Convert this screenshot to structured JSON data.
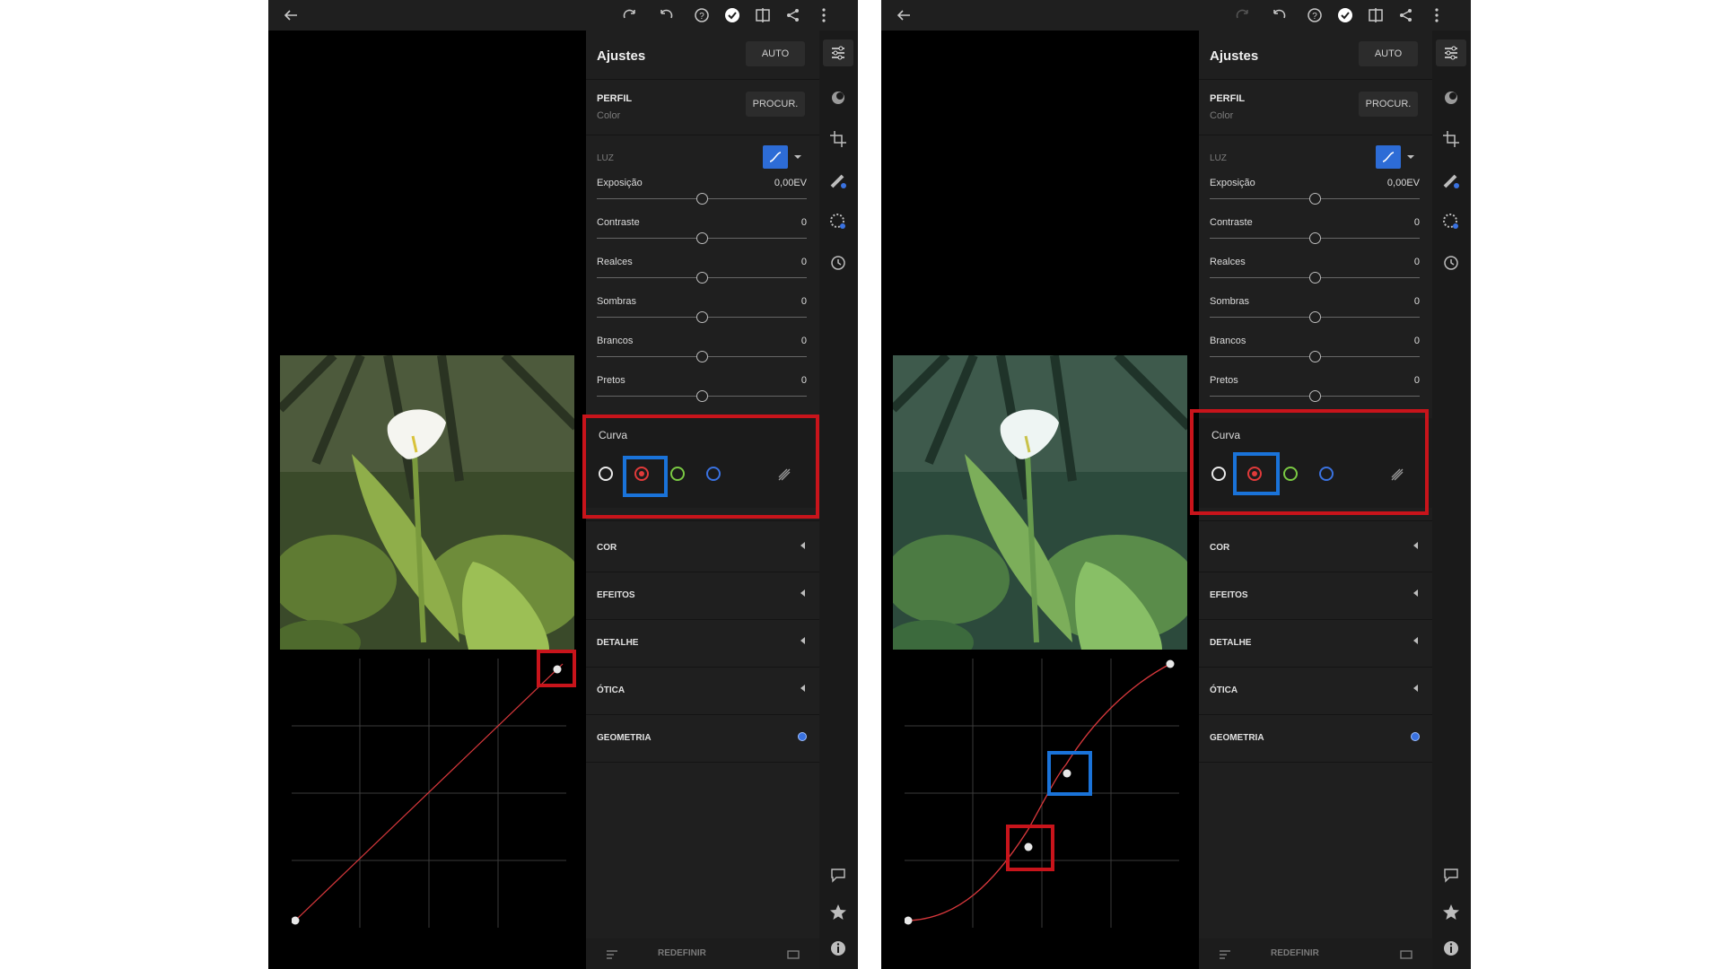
{
  "screens": [
    {
      "panel": {
        "title": "Ajustes",
        "auto_label": "AUTO",
        "perfil_label": "PERFIL",
        "perfil_value": "Color",
        "procurar_label": "PROCUR.",
        "luz_label": "LUZ",
        "sliders": [
          {
            "name": "Exposição",
            "value": "0,00EV"
          },
          {
            "name": "Contraste",
            "value": "0"
          },
          {
            "name": "Realces",
            "value": "0"
          },
          {
            "name": "Sombras",
            "value": "0"
          },
          {
            "name": "Brancos",
            "value": "0"
          },
          {
            "name": "Pretos",
            "value": "0"
          }
        ],
        "curva_label": "Curva",
        "sections": [
          "COR",
          "EFEITOS",
          "DETALHE",
          "ÓTICA",
          "GEOMETRIA"
        ],
        "redefinir_label": "REDEFINIR"
      },
      "curve_type": "linear"
    },
    {
      "panel": {
        "title": "Ajustes",
        "auto_label": "AUTO",
        "perfil_label": "PERFIL",
        "perfil_value": "Color",
        "procurar_label": "PROCUR.",
        "luz_label": "LUZ",
        "sliders": [
          {
            "name": "Exposição",
            "value": "0,00EV"
          },
          {
            "name": "Contraste",
            "value": "0"
          },
          {
            "name": "Realces",
            "value": "0"
          },
          {
            "name": "Sombras",
            "value": "0"
          },
          {
            "name": "Brancos",
            "value": "0"
          },
          {
            "name": "Pretos",
            "value": "0"
          }
        ],
        "curva_label": "Curva",
        "sections": [
          "COR",
          "EFEITOS",
          "DETALHE",
          "ÓTICA",
          "GEOMETRIA"
        ],
        "redefinir_label": "REDEFINIR"
      },
      "curve_type": "s-curve"
    }
  ],
  "colors": {
    "highlight_red": "#c8141b",
    "highlight_blue": "#1a73d9",
    "accent_blue": "#2d6cd6",
    "curve_red": "#d8383c"
  },
  "icons": {
    "topbar": [
      "back-arrow-icon",
      "redo-icon",
      "undo-icon",
      "help-icon",
      "done-check-icon",
      "compare-icon",
      "share-icon",
      "more-icon"
    ],
    "rail": [
      "adjustments-icon",
      "presets-icon",
      "crop-icon",
      "healing-icon",
      "selective-icon",
      "history-icon",
      "comment-icon",
      "star-icon",
      "info-icon"
    ]
  }
}
